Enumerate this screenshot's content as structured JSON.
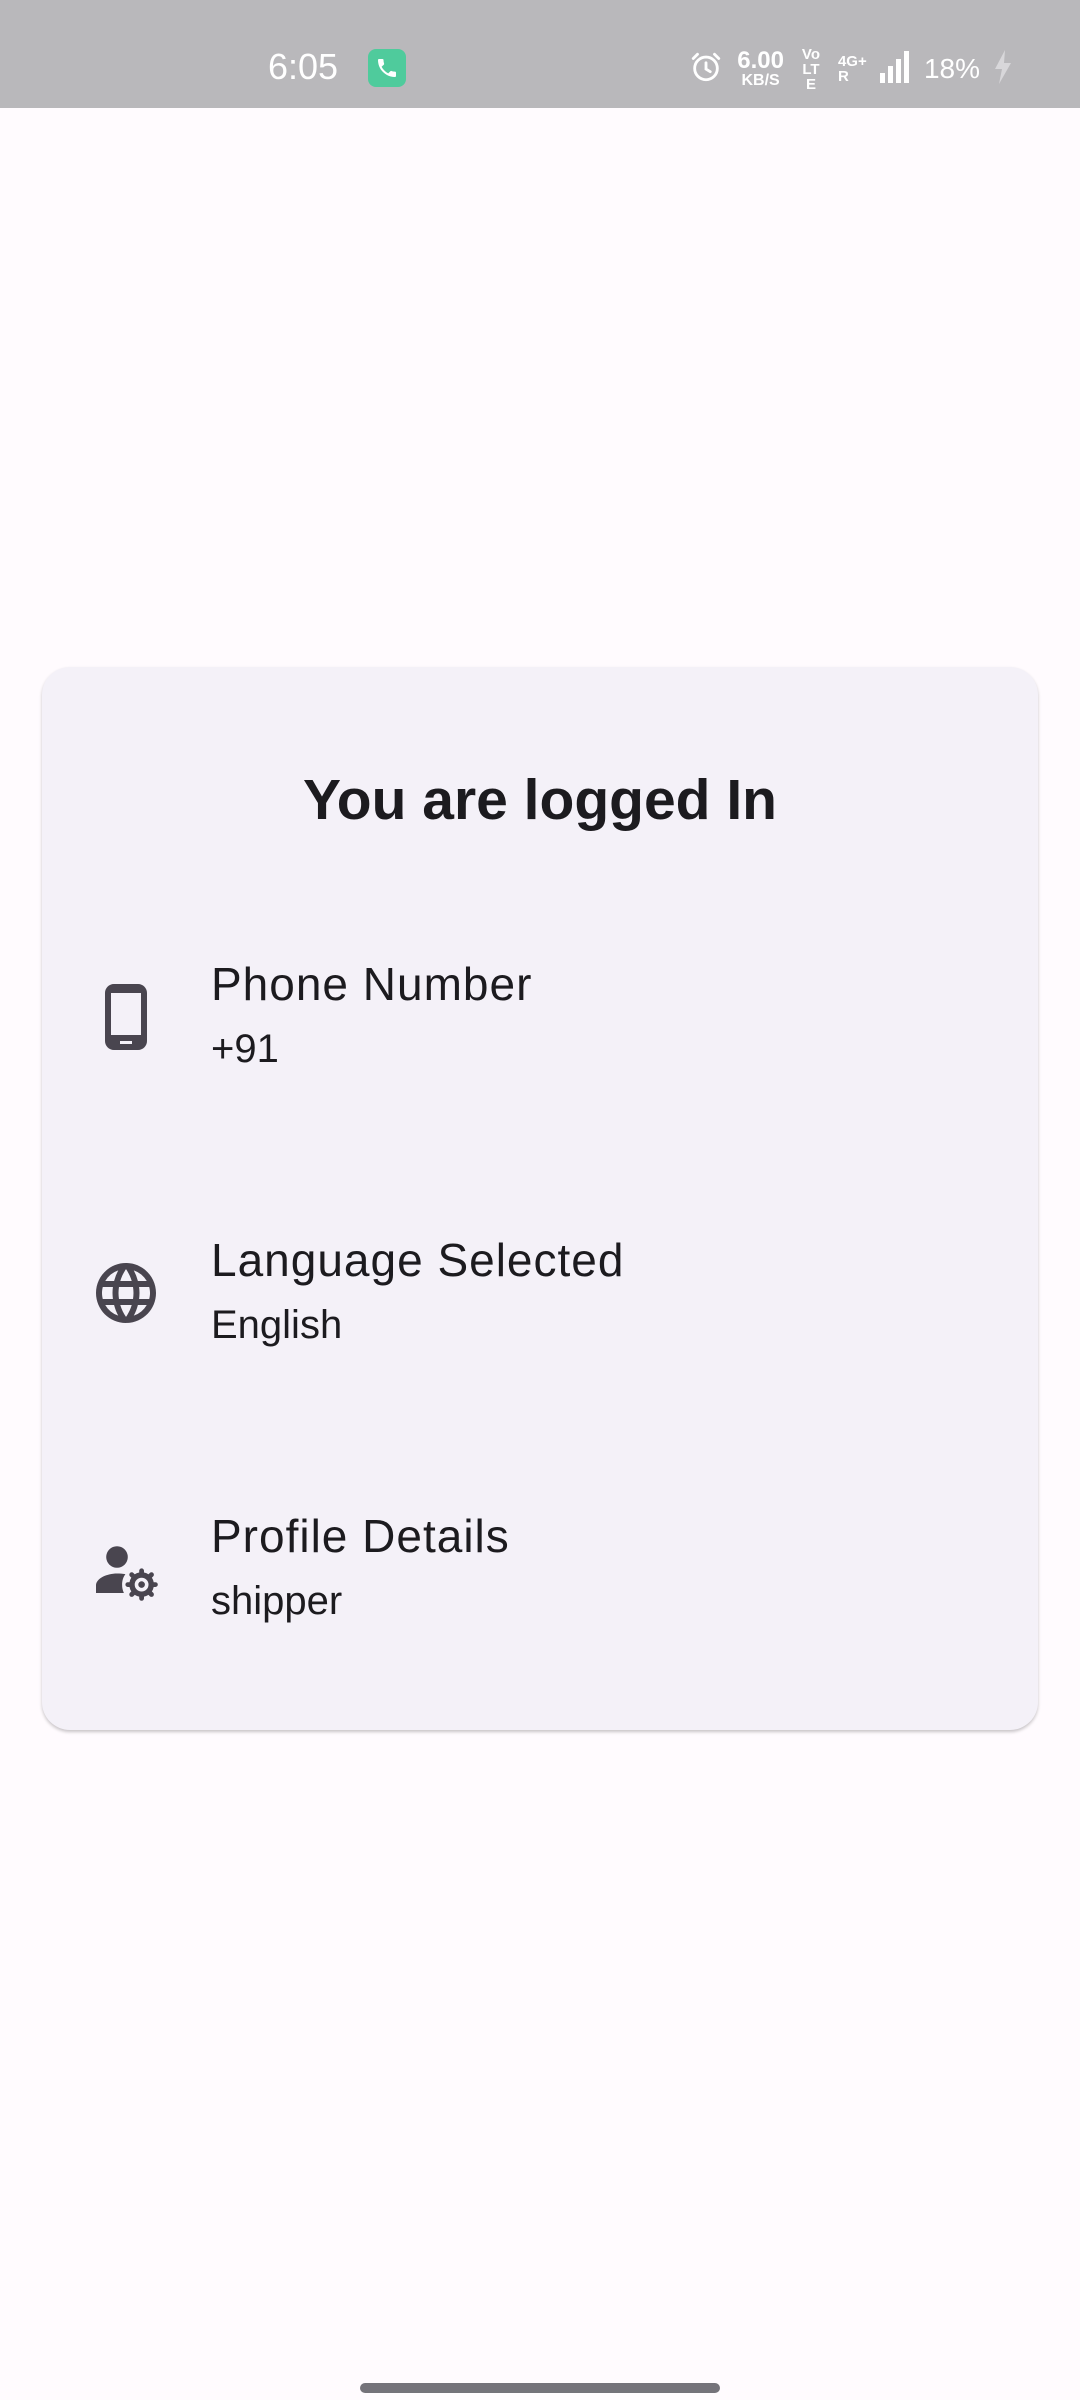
{
  "status_bar": {
    "time": "6:05",
    "speed_value": "6.00",
    "speed_unit": "KB/S",
    "volte": "Vo LTE",
    "network": "4G+ R",
    "battery": "18%"
  },
  "card": {
    "title": "You are logged In",
    "rows": [
      {
        "icon": "smartphone-icon",
        "title": "Phone Number",
        "value": "+91"
      },
      {
        "icon": "globe-icon",
        "title": "Language Selected",
        "value": "English"
      },
      {
        "icon": "manage-accounts-icon",
        "title": "Profile Details",
        "value": "shipper"
      }
    ]
  },
  "colors": {
    "background": "#FFFBFE",
    "card": "#F4F1F8",
    "status_bar": "#B9B8BB",
    "icon": "#49454F",
    "call_badge": "#4FCB9C"
  }
}
